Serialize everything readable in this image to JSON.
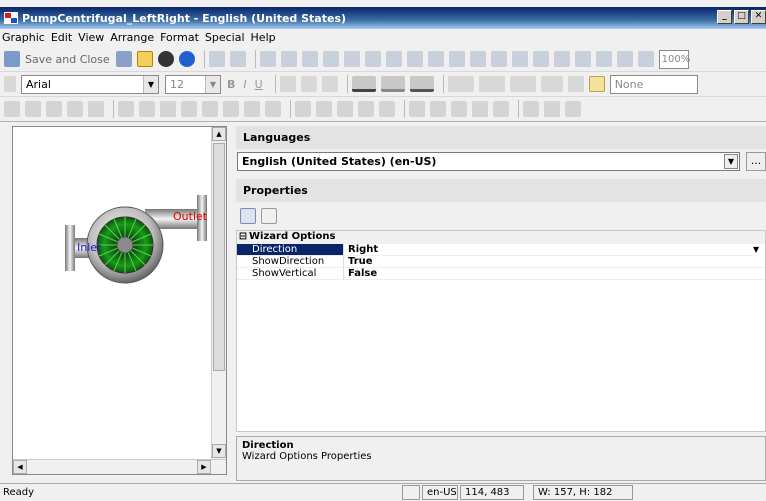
{
  "window": {
    "title": "PumpCentrifugal_LeftRight - English (United States)",
    "min": "_",
    "max": "□",
    "close": "✕"
  },
  "menu": [
    "Graphic",
    "Edit",
    "View",
    "Arrange",
    "Format",
    "Special",
    "Help"
  ],
  "toolbar": {
    "save_close": "Save and Close",
    "zoom": "100%"
  },
  "format": {
    "style_box": "",
    "font": "Arial",
    "size": "12",
    "bold": "B",
    "italic": "I",
    "underline": "U",
    "fill_none": "None"
  },
  "graphic": {
    "inlet": "Inlet",
    "outlet": "Outlet"
  },
  "languages": {
    "header": "Languages",
    "selected": "English (United States) (en-US)",
    "more": "..."
  },
  "properties": {
    "header": "Properties",
    "category": "Wizard Options",
    "rows": [
      {
        "name": "Direction",
        "value": "Right"
      },
      {
        "name": "ShowDirection",
        "value": "True"
      },
      {
        "name": "ShowVertical",
        "value": "False"
      }
    ]
  },
  "description": {
    "title": "Direction",
    "text": "Wizard Options Properties"
  },
  "status": {
    "ready": "Ready",
    "lang": "en-US",
    "pos": "114, 483",
    "size": "W: 157, H: 182"
  },
  "colors": {
    "title_start": "#0a246a",
    "selection": "#0a246a",
    "outlet": "#e00000",
    "inlet": "#2020d0",
    "pump_green": "#1a8a1a"
  }
}
